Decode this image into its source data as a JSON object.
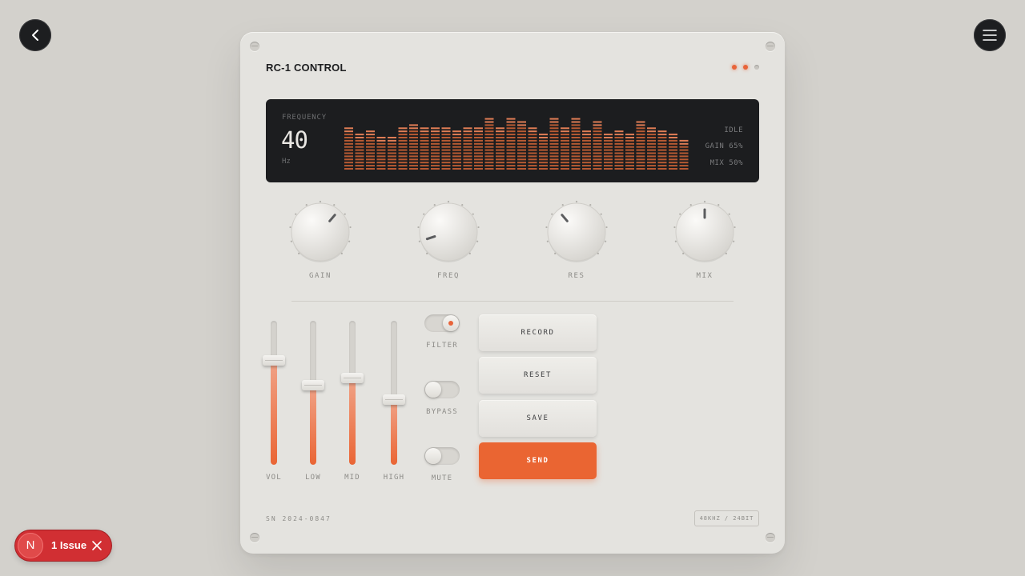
{
  "nav": {
    "back_icon": "chevron-left-icon",
    "menu_icon": "hamburger-menu-icon"
  },
  "device": {
    "title": "RC-1 CONTROL",
    "leds": [
      {
        "state": "on"
      },
      {
        "state": "on"
      },
      {
        "state": "off"
      }
    ],
    "accent_color": "#ea6532"
  },
  "display": {
    "freq_label": "FREQUENCY",
    "freq_value": "40",
    "freq_unit": "Hz",
    "status_idle": "IDLE",
    "status_gain": "GAIN 65%",
    "status_mix": "MIX 50%",
    "spectrum_levels": [
      0.8,
      0.7,
      0.76,
      0.64,
      0.64,
      0.82,
      0.88,
      0.82,
      0.82,
      0.82,
      0.76,
      0.82,
      0.82,
      1.0,
      0.82,
      1.0,
      0.94,
      0.82,
      0.7,
      1.0,
      0.82,
      1.0,
      0.76,
      0.94,
      0.7,
      0.76,
      0.7,
      0.94,
      0.82,
      0.76,
      0.7,
      0.58
    ]
  },
  "knobs": [
    {
      "label": "GAIN",
      "value_pct": 65
    },
    {
      "label": "FREQ",
      "value_pct": 10
    },
    {
      "label": "RES",
      "value_pct": 35
    },
    {
      "label": "MIX",
      "value_pct": 50
    }
  ],
  "faders": [
    {
      "label": "VOL",
      "value_pct": 72
    },
    {
      "label": "LOW",
      "value_pct": 55
    },
    {
      "label": "MID",
      "value_pct": 60
    },
    {
      "label": "HIGH",
      "value_pct": 45
    }
  ],
  "toggles": [
    {
      "label": "FILTER",
      "on": true
    },
    {
      "label": "BYPASS",
      "on": false
    },
    {
      "label": "MUTE",
      "on": false
    }
  ],
  "buttons": {
    "record": "RECORD",
    "reset": "RESET",
    "save": "SAVE",
    "send": "SEND"
  },
  "footer": {
    "serial": "SN 2024-0847",
    "spec": "48KHZ / 24BIT"
  },
  "issue_badge": {
    "logo_letter": "N",
    "text": "1 Issue",
    "close_icon": "close-icon"
  }
}
